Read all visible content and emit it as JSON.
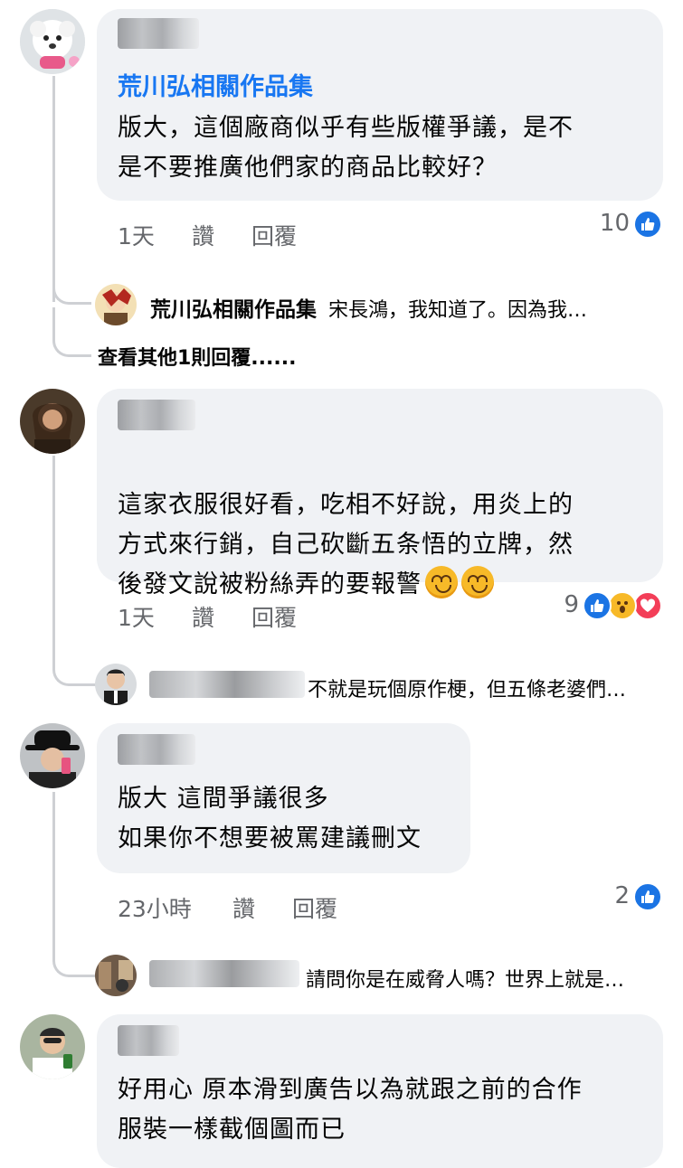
{
  "comments": [
    {
      "page_link": "荒川弘相關作品集",
      "text": "版大，這個廠商似乎有些版權爭議，是不\n是不要推廣他們家的商品比較好？",
      "time": "1天",
      "like": "讚",
      "reply": "回覆",
      "reaction_count": "10",
      "reply_preview": {
        "author": "荒川弘相關作品集",
        "text": "宋長鴻，我知道了。因為我…"
      },
      "view_more": "查看其他1則回覆......"
    },
    {
      "text": "這家衣服很好看，吃相不好說，用炎上的\n方式來行銷，自己砍斷五条悟的立牌，然\n後發文說被粉絲弄的要報警",
      "time": "1天",
      "like": "讚",
      "reply": "回覆",
      "reaction_count": "9",
      "reply_preview": {
        "text": "不就是玩個原作梗，但五條老婆們…"
      }
    },
    {
      "text": "版大 這間爭議很多\n如果你不想要被罵建議刪文",
      "time": "23小時",
      "like": "讚",
      "reply": "回覆",
      "reaction_count": "2",
      "reply_preview": {
        "text": "請問你是在威脅人嗎？世界上就是…"
      }
    },
    {
      "text": "好用心 原本滑到廣告以為就跟之前的合作\n服裝一樣截個圖而已"
    }
  ],
  "colors": {
    "like": "#1b74e4",
    "love": "#f33e58",
    "wow": "#f7b928",
    "link": "#1877f2",
    "bubble": "#f0f2f5"
  }
}
